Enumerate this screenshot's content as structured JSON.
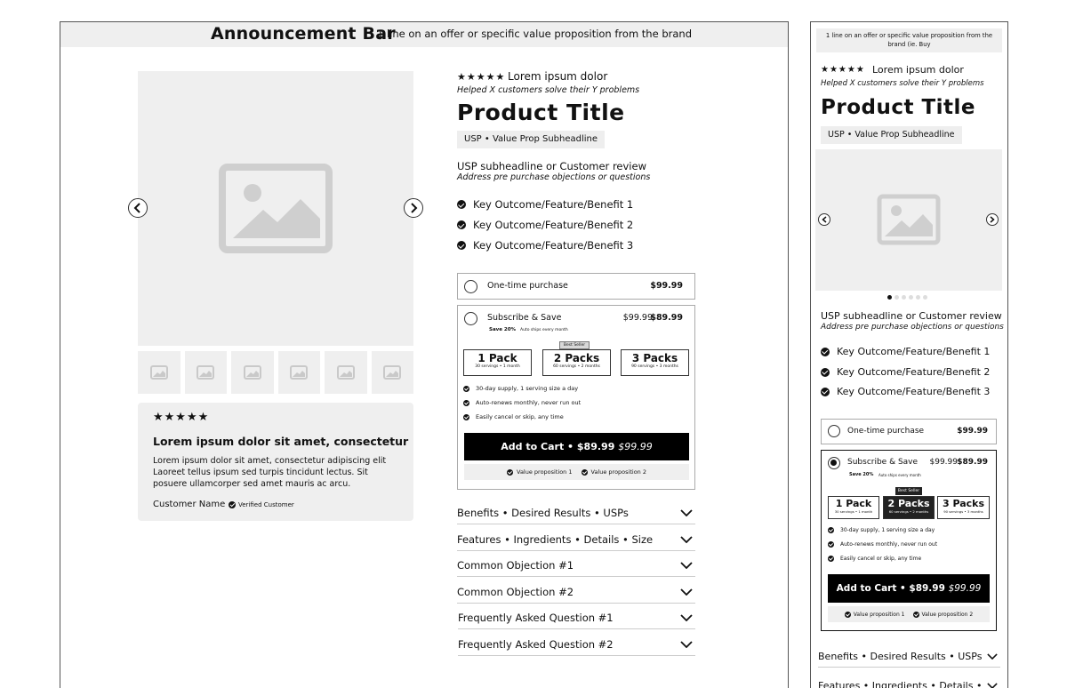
{
  "desktop": {
    "announcement": {
      "title": "Announcement Bar",
      "text": "1 line on an offer or specific value proposition from the brand"
    },
    "rating": {
      "stars": "★★★★★",
      "label": "Lorem ipsum dolor"
    },
    "helped": "Helped X customers solve their Y problems",
    "product_title": "Product Title",
    "usp_chip": "USP • Value Prop Subheadline",
    "usp_headline": "USP subheadline or Customer review",
    "usp_sub": "Address pre purchase objections or questions",
    "benefits": [
      "Key Outcome/Feature/Benefit 1",
      "Key Outcome/Feature/Benefit 2",
      "Key Outcome/Feature/Benefit 3"
    ],
    "review": {
      "stars": "★★★★★",
      "title": "Lorem ipsum dolor sit amet, consectetur",
      "body": "Lorem ipsum dolor sit amet, consectetur adipiscing elit  Laoreet tellus ipsum sed turpis tincidunt lectus. Sit posuere ullamcorper sed amet mauris ac arcu.",
      "customer": "Customer Name",
      "verified": "Verified Customer"
    },
    "one_time": {
      "label": "One-time purchase",
      "price": "$99.99"
    },
    "subscribe": {
      "label": "Subscribe & Save",
      "old_price": "$99.99",
      "price": "$89.99",
      "save": "Save 20%",
      "ships": "Auto ships every month",
      "best_seller": "Best Seller",
      "packs": [
        {
          "title": "1 Pack",
          "sub": "30 servings • 1 month"
        },
        {
          "title": "2 Packs",
          "sub": "60 servings • 2 months"
        },
        {
          "title": "3 Packs",
          "sub": "90 servings • 3 months"
        }
      ],
      "points": [
        "30-day supply, 1 serving size a day",
        "Auto-renews monthly, never run out",
        "Easily cancel or skip, any time"
      ],
      "cart_label": "Add to Cart • $89.99",
      "cart_old": "$99.99",
      "value_props": [
        "Value proposition 1",
        "Value proposition 2"
      ]
    },
    "accordions": [
      "Benefits • Desired Results • USPs",
      "Features • Ingredients • Details • Size",
      "Common Objection #1",
      "Common Objection #2",
      "Frequently Asked Question #1",
      "Frequently Asked Question #2"
    ]
  },
  "mobile": {
    "announcement": "1 line on an offer or specific value proposition from the brand (ie. Buy",
    "rating": {
      "stars": "★★★★★",
      "label": "Lorem ipsum dolor"
    },
    "helped": "Helped X customers solve their Y problems",
    "product_title": "Product Title",
    "usp_chip": "USP • Value Prop Subheadline",
    "usp_headline": "USP subheadline or Customer review",
    "usp_sub": "Address pre purchase objections or questions",
    "benefits": [
      "Key Outcome/Feature/Benefit 1",
      "Key Outcome/Feature/Benefit 2",
      "Key Outcome/Feature/Benefit 3"
    ],
    "one_time": {
      "label": "One-time purchase",
      "price": "$99.99"
    },
    "subscribe": {
      "label": "Subscribe & Save",
      "old_price": "$99.99",
      "price": "$89.99",
      "save": "Save 20%",
      "ships": "Auto ships every month",
      "best_seller": "Best Seller",
      "packs": [
        {
          "title": "1 Pack",
          "sub": "30 servings • 1 month"
        },
        {
          "title": "2 Packs",
          "sub": "60 servings • 2 months"
        },
        {
          "title": "3 Packs",
          "sub": "90 servings • 3 months"
        }
      ],
      "points": [
        "30-day supply, 1 serving size a day",
        "Auto-renews monthly, never run out",
        "Easily cancel or skip, any time"
      ],
      "cart_label": "Add to Cart • $89.99",
      "cart_old": "$99.99",
      "value_props": [
        "Value proposition 1",
        "Value proposition 2"
      ]
    },
    "accordions": [
      "Benefits • Desired Results • USPs",
      "Features • Ingredients • Details • Size"
    ]
  }
}
